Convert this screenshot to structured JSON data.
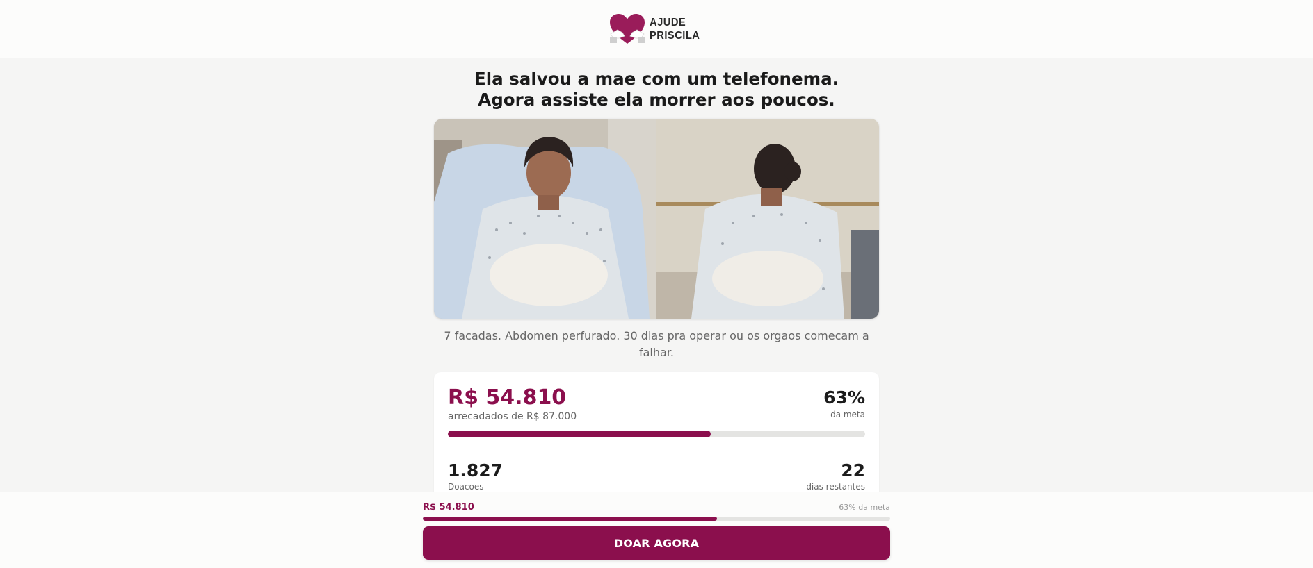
{
  "header": {
    "logo_line1": "AJUDE",
    "logo_line2": "PRISCILA",
    "logo_icon": "heart-hands-icon"
  },
  "main": {
    "headline": "Ela salvou a mae com um telefonema. Agora assiste ela morrer aos poucos.",
    "caption": "7 facadas. Abdomen perfurado. 30 dias pra operar ou os orgaos comecam a falhar."
  },
  "stats": {
    "raised": "R$ 54.810",
    "raised_sub": "arrecadados de R$ 87.000",
    "percent": "63%",
    "percent_sub": "da meta",
    "progress": 0.63,
    "donations": "1.827",
    "donations_label": "Doacoes",
    "days": "22",
    "days_label": "dias restantes"
  },
  "bottom_bar": {
    "raised": "R$ 54.810",
    "percent_text": "63% da meta",
    "progress": 0.63,
    "cta": "DOAR AGORA"
  },
  "colors": {
    "brand": "#8b0f4d",
    "background": "#f5f5f4"
  }
}
